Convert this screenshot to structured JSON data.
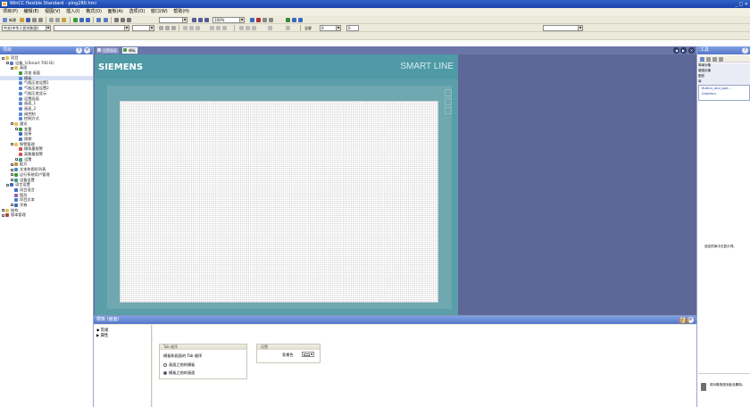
{
  "window": {
    "title": "WinCC flexible Standard - ping280.hmi"
  },
  "menu": [
    "项目(P)",
    "编辑(E)",
    "视图(V)",
    "插入(I)",
    "格式(O)",
    "面板(A)",
    "选项(O)",
    "窗口(W)",
    "帮助(H)"
  ],
  "toolbar": {
    "new_label": "新建",
    "zoom_value": "100%",
    "language": "中文(中华人民共和国)",
    "fullscreen_label": "全屏",
    "coord_value": "0",
    "offset_value": "0"
  },
  "project": {
    "title": "项目",
    "tree": [
      {
        "level": 0,
        "label": "项目",
        "icon": "folder-icon",
        "exp": "-"
      },
      {
        "level": 1,
        "label": "设备_1(Smart 700 IE)",
        "icon": "device-icon",
        "exp": "-"
      },
      {
        "level": 2,
        "label": "画面",
        "icon": "folder-icon",
        "exp": "-"
      },
      {
        "level": 3,
        "label": "添加 画面",
        "icon": "add-icon",
        "exp": ""
      },
      {
        "level": 3,
        "label": "模板",
        "icon": "screen-icon",
        "exp": ""
      },
      {
        "level": 3,
        "label": "气瓶压差设置1",
        "icon": "screen-icon",
        "exp": ""
      },
      {
        "level": 3,
        "label": "气瓶压差设置2",
        "icon": "screen-icon",
        "exp": ""
      },
      {
        "level": 3,
        "label": "气瓶压差显示",
        "icon": "screen-icon",
        "exp": ""
      },
      {
        "level": 3,
        "label": "设置画面",
        "icon": "screen-icon",
        "exp": ""
      },
      {
        "level": 3,
        "label": "画面_1",
        "icon": "screen-icon",
        "exp": ""
      },
      {
        "level": 3,
        "label": "画面_2",
        "icon": "screen-icon",
        "exp": ""
      },
      {
        "level": 3,
        "label": "阀控制",
        "icon": "screen-icon",
        "exp": ""
      },
      {
        "level": 3,
        "label": "控制方式",
        "icon": "screen-icon",
        "exp": ""
      },
      {
        "level": 2,
        "label": "通讯",
        "icon": "folder-icon",
        "exp": "-"
      },
      {
        "level": 3,
        "label": "变量",
        "icon": "tag-icon",
        "exp": "+"
      },
      {
        "level": 3,
        "label": "连接",
        "icon": "connection-icon",
        "exp": ""
      },
      {
        "level": 3,
        "label": "周期",
        "icon": "cycle-icon",
        "exp": ""
      },
      {
        "level": 2,
        "label": "报警管理",
        "icon": "folder-icon",
        "exp": "-"
      },
      {
        "level": 3,
        "label": "模拟量报警",
        "icon": "alarm-icon",
        "exp": ""
      },
      {
        "level": 3,
        "label": "离散量报警",
        "icon": "alarm-icon",
        "exp": ""
      },
      {
        "level": 3,
        "label": "设置",
        "icon": "settings-icon",
        "exp": "+"
      },
      {
        "level": 2,
        "label": "配方",
        "icon": "recipe-icon",
        "exp": "+"
      },
      {
        "level": 2,
        "label": "文本和图形列表",
        "icon": "list-icon",
        "exp": "+"
      },
      {
        "level": 2,
        "label": "运行系统用户管理",
        "icon": "user-icon",
        "exp": "+"
      },
      {
        "level": 2,
        "label": "设备设置",
        "icon": "settings-icon",
        "exp": "+"
      },
      {
        "level": 1,
        "label": "语言设置",
        "icon": "language-icon",
        "exp": "-"
      },
      {
        "level": 2,
        "label": "项目语言",
        "icon": "language-icon",
        "exp": ""
      },
      {
        "level": 2,
        "label": "图形",
        "icon": "graphic-icon",
        "exp": ""
      },
      {
        "level": 2,
        "label": "项目文本",
        "icon": "text-icon",
        "exp": ""
      },
      {
        "level": 2,
        "label": "字典",
        "icon": "dictionary-icon",
        "exp": "+"
      },
      {
        "level": 0,
        "label": "结构",
        "icon": "folder-icon",
        "exp": "+"
      },
      {
        "level": 0,
        "label": "版本管理",
        "icon": "version-icon",
        "exp": "+"
      }
    ]
  },
  "tabs": [
    {
      "label": "设置画面"
    },
    {
      "label": "模板"
    }
  ],
  "panel": {
    "brand": "SIEMENS",
    "series": "SMART LINE"
  },
  "tools": {
    "title": "工具",
    "rows": [
      "简单对象",
      "增强对象",
      "图形",
      "库",
      "Button_and_swit...",
      "Graphics"
    ],
    "hint": "选定的库中无显示项。",
    "footer_hint": "将对象拖放到此处删除。"
  },
  "properties": {
    "title": "模板 (画面)",
    "mode": "常规",
    "nav": [
      "常规",
      "属性"
    ],
    "tab_group": "Tab 顺序",
    "tab_desc": "模板和画面的 Tab 顺序",
    "option1": "画面之前的模板",
    "option2": "模板之前的画面",
    "settings_group": "设置",
    "bgcolor_label": "背景色"
  },
  "colors": {
    "accent": "#2f62c8",
    "panel": "#5a9eaa",
    "canvas_bg": "#5e6898"
  }
}
